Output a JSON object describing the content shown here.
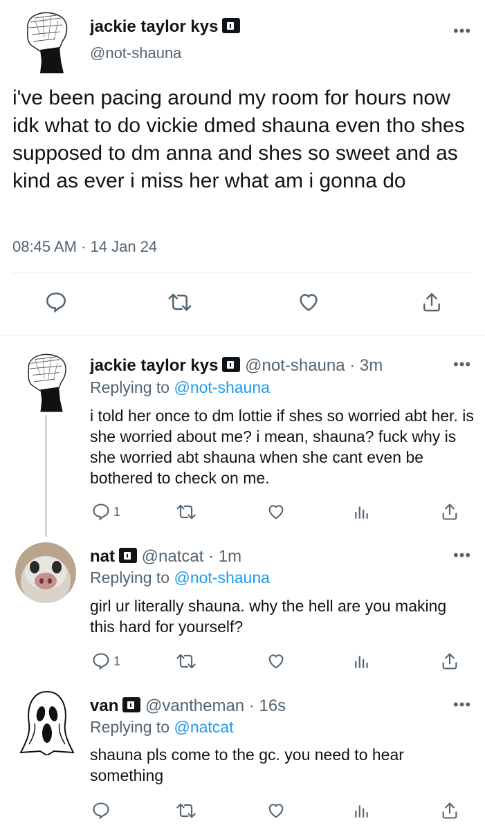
{
  "main_tweet": {
    "display_name": "jackie taylor kys",
    "handle": "@not-shauna",
    "text": "i've been pacing around my room for hours now idk what to do vickie dmed shauna even tho shes supposed to dm anna and shes so sweet and as kind as ever i miss her what am i gonna do",
    "time": "08:45 AM",
    "date": "14 Jan 24",
    "separator": "·"
  },
  "replies": [
    {
      "display_name": "jackie taylor kys",
      "handle_meta": "@not-shauna · 3m",
      "replying_prefix": "Replying to",
      "replying_to": "@not-shauna",
      "text": "i told her once to dm lottie if shes so worried abt her. is she worried about me? i mean, shauna? fuck why is she worried abt shauna when she cant even be bothered to check on me.",
      "reply_count": "1"
    },
    {
      "display_name": "nat",
      "handle_meta": "@natcat · 1m",
      "replying_prefix": "Replying to",
      "replying_to": "@not-shauna",
      "text": "girl ur literally shauna. why the hell are you making this hard for yourself?",
      "reply_count": "1"
    },
    {
      "display_name": "van",
      "handle_meta": "@vantheman · 16s",
      "replying_prefix": "Replying to",
      "replying_to": "@natcat",
      "text": "shauna pls come to the gc. you need to hear something",
      "reply_count": ""
    }
  ],
  "icons": {
    "reply": "reply-icon",
    "retweet": "retweet-icon",
    "like": "heart-icon",
    "analytics": "analytics-icon",
    "share": "share-icon",
    "more": "more-icon",
    "lock": "lock-icon"
  },
  "colors": {
    "link": "#1d9bf0",
    "muted": "#536471",
    "text": "#0f1419",
    "divider": "#e6e8ea"
  }
}
